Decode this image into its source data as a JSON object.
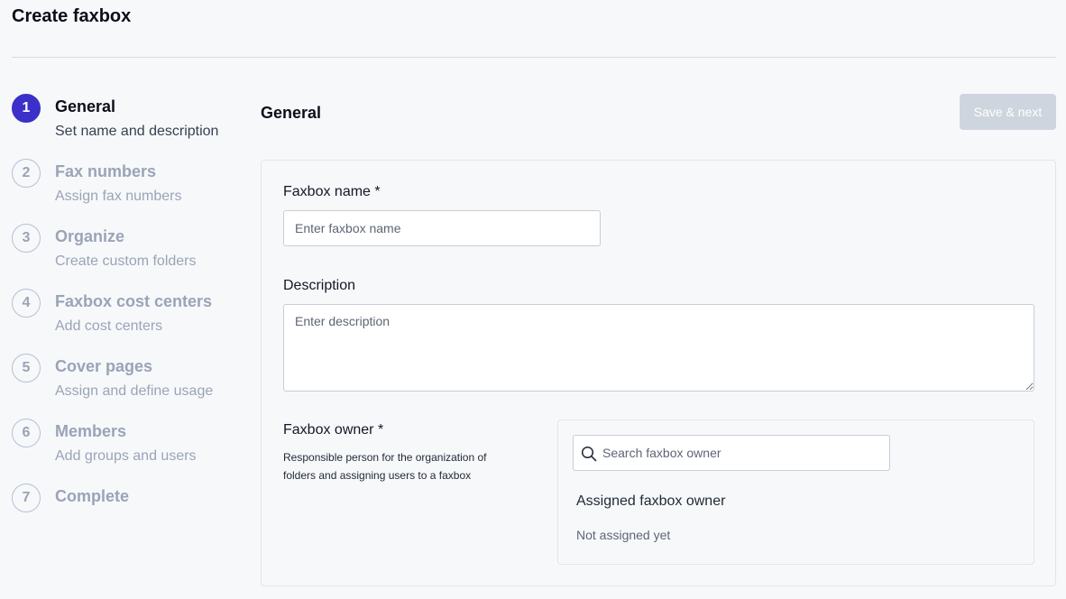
{
  "header": {
    "title": "Create faxbox"
  },
  "stepper": {
    "steps": [
      {
        "number": "1",
        "title": "General",
        "subtitle": "Set name and description",
        "active": true
      },
      {
        "number": "2",
        "title": "Fax numbers",
        "subtitle": "Assign fax numbers",
        "active": false
      },
      {
        "number": "3",
        "title": "Organize",
        "subtitle": "Create custom folders",
        "active": false
      },
      {
        "number": "4",
        "title": "Faxbox cost centers",
        "subtitle": "Add cost centers",
        "active": false
      },
      {
        "number": "5",
        "title": "Cover pages",
        "subtitle": "Assign and define usage",
        "active": false
      },
      {
        "number": "6",
        "title": "Members",
        "subtitle": "Add groups and users",
        "active": false
      },
      {
        "number": "7",
        "title": "Complete",
        "subtitle": "",
        "active": false
      }
    ]
  },
  "main": {
    "section_title": "General",
    "save_label": "Save & next",
    "form": {
      "name_label": "Faxbox name *",
      "name_placeholder": "Enter faxbox name",
      "name_value": "",
      "description_label": "Description",
      "description_placeholder": "Enter description",
      "description_value": "",
      "owner_label": "Faxbox owner *",
      "owner_help": "Responsible person for the organization of folders and assigning users to a faxbox",
      "owner_search_placeholder": "Search faxbox owner",
      "assigned_owner_title": "Assigned faxbox owner",
      "assigned_owner_value": "Not assigned yet"
    }
  },
  "icons": {
    "search": "search-icon"
  },
  "colors": {
    "accent": "#3b30c9",
    "step_inactive": "#9aa4b7",
    "button_disabled": "#cfd5de",
    "background": "#f7f8fa"
  }
}
